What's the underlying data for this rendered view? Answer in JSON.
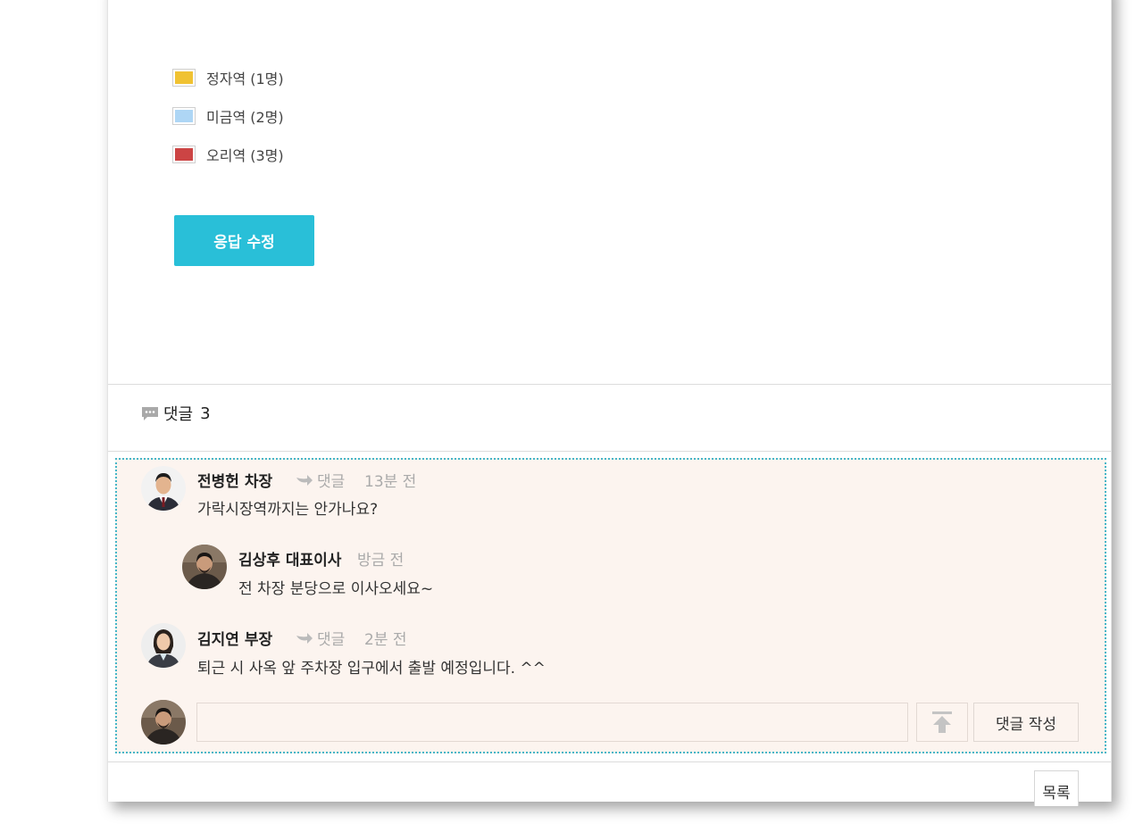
{
  "chart_data": {
    "type": "pie",
    "categories": [
      "정자역 (1명)",
      "미금역 (2명)",
      "오리역 (3명)"
    ],
    "values": [
      1,
      2,
      3
    ],
    "colors": [
      "#f0c232",
      "#aed6f5",
      "#cc4444"
    ]
  },
  "legend": [
    {
      "label": "정자역 (1명)",
      "color": "#f0c232"
    },
    {
      "label": "미금역 (2명)",
      "color": "#aed6f5"
    },
    {
      "label": "오리역 (3명)",
      "color": "#cc4444"
    }
  ],
  "poll": {
    "edit_button": "응답 수정"
  },
  "comments_section": {
    "title": "댓글",
    "count": "3",
    "comment_icon": "speech-bubble-icon",
    "reply_icon": "reply-arrow-icon",
    "comments": [
      {
        "author": "전병헌 차장",
        "reply_label": "댓글",
        "time": "13분 전",
        "text": "가락시장역까지는 안가나요?"
      },
      {
        "author": "김상후 대표이사",
        "time": "방금 전",
        "text": "전 차장 분당으로 이사오세요~"
      },
      {
        "author": "김지연 부장",
        "reply_label": "댓글",
        "time": "2분 전",
        "text": "퇴근 시 사옥 앞 주차장 입구에서 출발 예정입니다. ^^"
      }
    ],
    "input": {
      "placeholder": "",
      "value": ""
    },
    "upload_icon": "upload-arrow-icon",
    "submit_label": "댓글 작성"
  },
  "footer": {
    "list_button": "목록"
  },
  "accent_colors": {
    "primary_button": "#29bfd8",
    "comment_bg": "#fcf4ef",
    "comment_border": "#46b6c8"
  }
}
